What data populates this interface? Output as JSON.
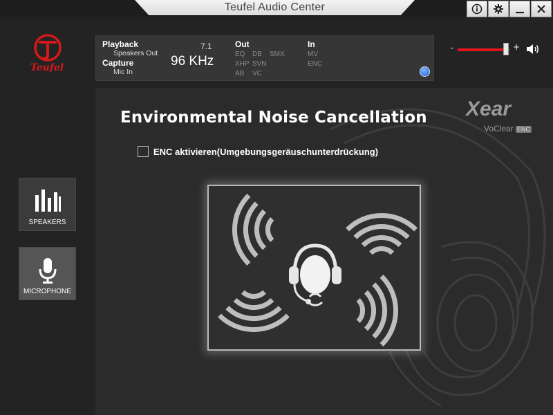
{
  "window": {
    "title": "Teufel Audio Center",
    "buttons": {
      "info": "i",
      "settings": "gear",
      "minimize": "_",
      "close": "X"
    }
  },
  "brand": {
    "logo_text": "Teufel",
    "accent": "#d5191b"
  },
  "info_panel": {
    "playback_label": "Playback",
    "playback_device": "Speakers Out",
    "capture_label": "Capture",
    "capture_device": "Mic In",
    "channels": "7.1",
    "sample_rate": "96 KHz",
    "out_label": "Out",
    "out_features": [
      "EQ",
      "DB",
      "SMX",
      "XHP",
      "SVN",
      "AB",
      "VC"
    ],
    "in_label": "In",
    "in_features": [
      "MV",
      "ENC"
    ]
  },
  "volume": {
    "minus": "-",
    "plus": "+",
    "level": 0.93
  },
  "nav": {
    "speakers_label": "SPEAKERS",
    "microphone_label": "MICROPHONE"
  },
  "main": {
    "title": "Environmental Noise Cancellation",
    "xear_logo": "Xear",
    "xear_sub": "VoClear",
    "xear_badge": "ENC",
    "checkbox_label": "ENC aktivieren(Umgebungsgeräuschunterdrückung)",
    "checkbox_checked": false
  },
  "icons": {
    "info": "info-icon",
    "settings": "gear-icon",
    "minimize": "minimize-icon",
    "close": "close-icon",
    "speaker": "speaker-icon",
    "speakers_nav": "equalizer-bars-icon",
    "microphone_nav": "microphone-icon",
    "refresh": "refresh-icon",
    "headset": "headset-icon",
    "sound_waves": "sound-waves-icon"
  }
}
